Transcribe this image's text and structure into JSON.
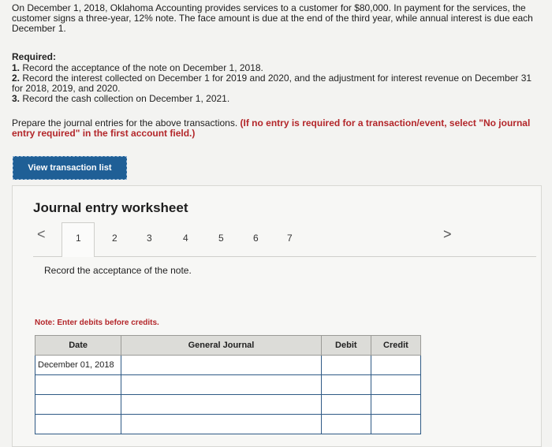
{
  "problem": {
    "intro": "On December 1, 2018, Oklahoma Accounting provides services to a customer for $80,000. In payment for the services, the customer signs a three-year, 12% note. The face amount is due at the end of the third year, while annual interest is due each December 1.",
    "required_title": "Required:",
    "req1_num": "1.",
    "req1": "Record the acceptance of the note on December 1, 2018.",
    "req2_num": "2.",
    "req2": "Record the interest collected on December 1 for 2019 and 2020, and the adjustment for interest revenue on December 31 for 2018, 2019, and 2020.",
    "req3_num": "3.",
    "req3": "Record the cash collection on December 1, 2021.",
    "prepare": "Prepare the journal entries for the above transactions.",
    "prepare_note": "(If no entry is required for a transaction/event, select \"No journal entry required\" in the first account field.)"
  },
  "buttons": {
    "view_transactions": "View transaction list"
  },
  "worksheet": {
    "title": "Journal entry worksheet",
    "prev": "<",
    "next": ">",
    "tabs": [
      "1",
      "2",
      "3",
      "4",
      "5",
      "6",
      "7"
    ],
    "instruction": "Record the acceptance of the note.",
    "note": "Note: Enter debits before credits."
  },
  "journal": {
    "headers": {
      "date": "Date",
      "general_journal": "General Journal",
      "debit": "Debit",
      "credit": "Credit"
    },
    "rows": [
      {
        "date": "December 01, 2018",
        "account": "",
        "debit": "",
        "credit": ""
      },
      {
        "date": "",
        "account": "",
        "debit": "",
        "credit": ""
      },
      {
        "date": "",
        "account": "",
        "debit": "",
        "credit": ""
      },
      {
        "date": "",
        "account": "",
        "debit": "",
        "credit": ""
      }
    ]
  }
}
